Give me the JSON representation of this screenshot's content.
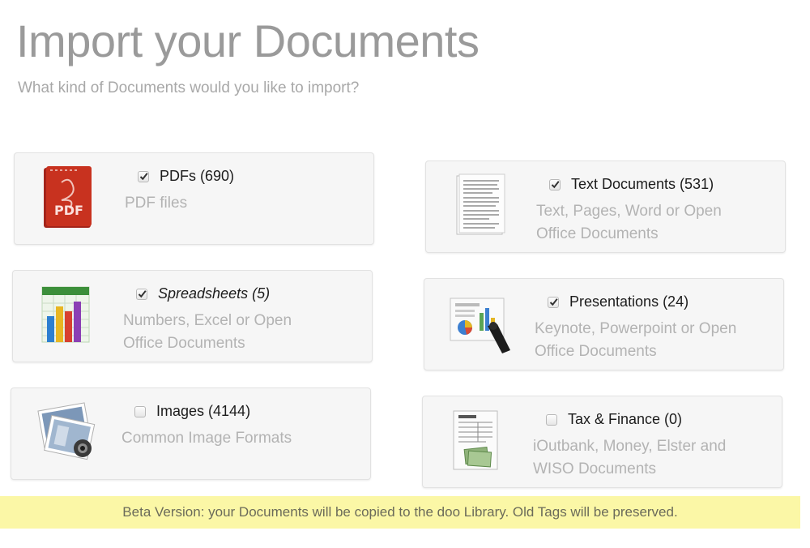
{
  "header": {
    "title": "Import your Documents",
    "subtitle": "What kind of Documents would you like to import?"
  },
  "cards": [
    {
      "icon": "pdf-document-icon",
      "icon_text": "PDF",
      "checked": true,
      "label": "PDFs (690)",
      "desc": "PDF files"
    },
    {
      "icon": "text-document-icon",
      "checked": true,
      "label": "Text Documents (531)",
      "desc": "Text, Pages, Word or Open Office Documents"
    },
    {
      "icon": "spreadsheet-chart-icon",
      "checked": true,
      "label": "Spreadsheets (5)",
      "desc": "Numbers, Excel or Open Office Documents"
    },
    {
      "icon": "presentation-icon",
      "checked": true,
      "label": "Presentations (24)",
      "desc": "Keynote, Powerpoint or Open Office Documents"
    },
    {
      "icon": "photo-images-icon",
      "checked": false,
      "label": "Images (4144)",
      "desc": "Common Image Formats"
    },
    {
      "icon": "tax-form-icon",
      "checked": false,
      "label": "Tax & Finance (0)",
      "desc": "iOutbank, Money, Elster and WISO Documents"
    }
  ],
  "footer": {
    "beta_notice": "Beta Version: your Documents will be copied to the doo Library. Old Tags will be preserved."
  },
  "colors": {
    "title": "#9a9a9a",
    "description": "#b3b3b3",
    "card_background": "#f6f6f6",
    "beta_highlight": "#fbf7a6",
    "pdf_red": "#c8321f"
  }
}
